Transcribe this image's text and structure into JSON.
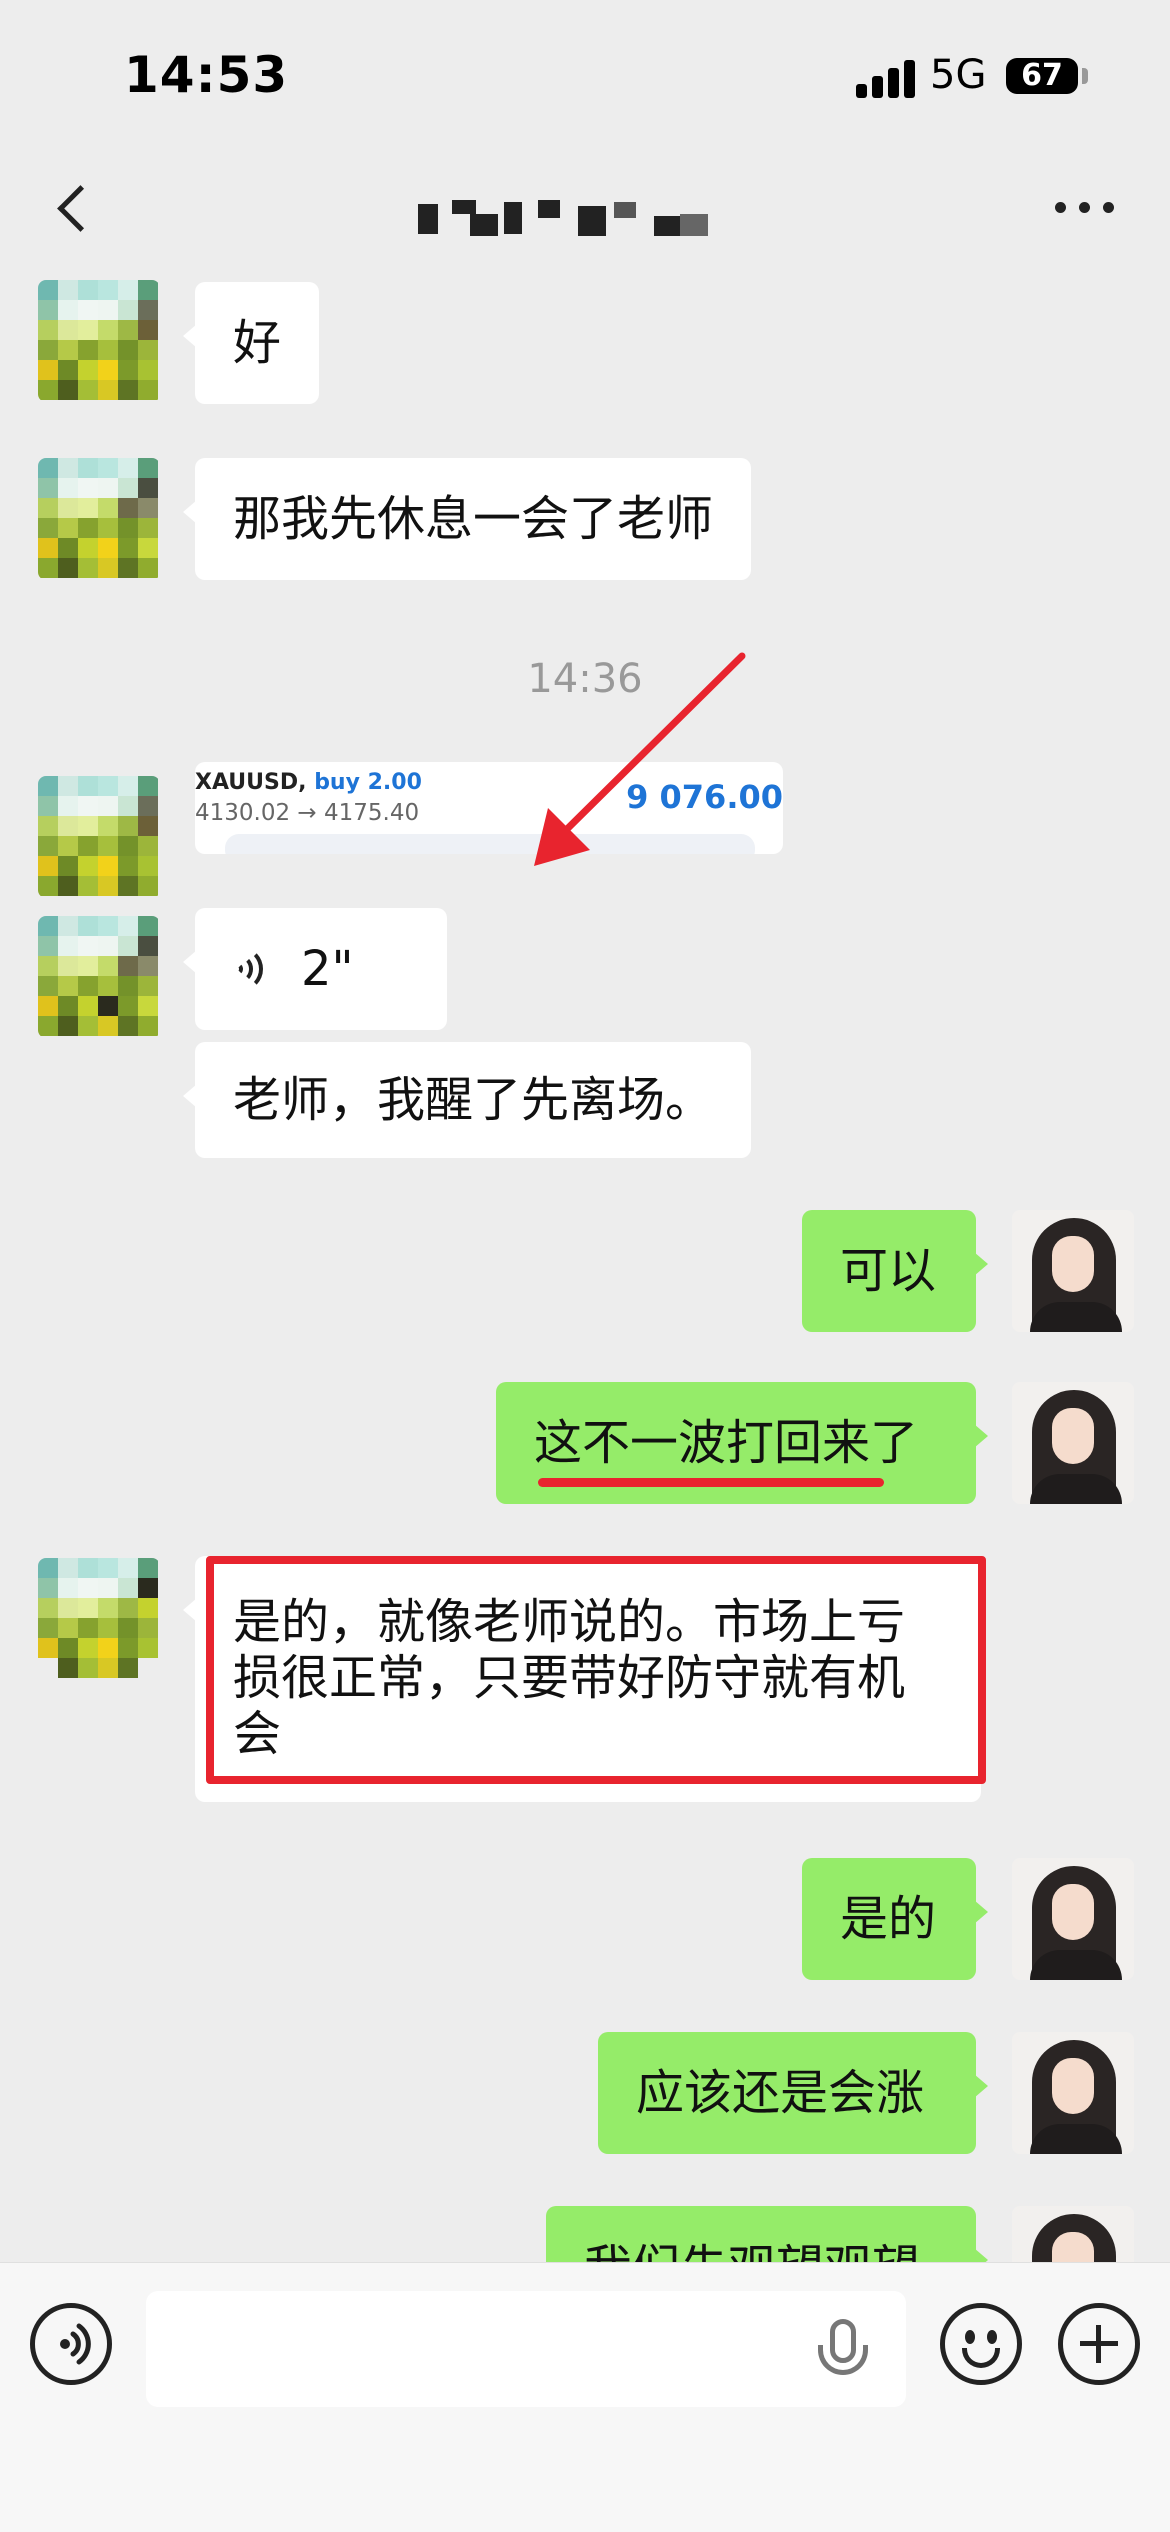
{
  "status_bar": {
    "time": "14:53",
    "network": "5G",
    "battery": "67"
  },
  "nav": {
    "title": "",
    "back_icon": "chevron-left-icon",
    "more_icon": "more-dots-icon"
  },
  "messages": [
    {
      "side": "left",
      "type": "text",
      "text": "好"
    },
    {
      "side": "left",
      "type": "text",
      "text": "那我先休息一会了老师"
    },
    {
      "side": "left",
      "type": "card",
      "symbol": "XAUUSD,",
      "action": "buy 2.00",
      "price_range": "4130.02 → 4175.40",
      "profit": "9 076.00"
    },
    {
      "side": "left",
      "type": "voice",
      "duration": "2\""
    },
    {
      "side": "left",
      "type": "text",
      "text": "老师，我醒了先离场。"
    },
    {
      "side": "right",
      "type": "text",
      "text": "可以"
    },
    {
      "side": "right",
      "type": "text",
      "text": "这不一波打回来了"
    },
    {
      "side": "left",
      "type": "text",
      "text": "是的，就像老师说的。市场上亏损很正常，只要带好防守就有机会"
    },
    {
      "side": "right",
      "type": "text",
      "text": "是的"
    },
    {
      "side": "right",
      "type": "text",
      "text": "应该还是会涨"
    },
    {
      "side": "right",
      "type": "text",
      "text": "我们先观望观望"
    }
  ],
  "timestamp": "14:36",
  "colors": {
    "right_bubble": "#95ec69",
    "left_bubble": "#ffffff",
    "background": "#ededed",
    "annotation": "#e8242e",
    "profit": "#1e74d6"
  },
  "input_bar": {
    "voice_icon": "voice-toggle-icon",
    "mic_icon": "microphone-icon",
    "emoji_icon": "emoji-icon",
    "plus_icon": "plus-icon"
  }
}
